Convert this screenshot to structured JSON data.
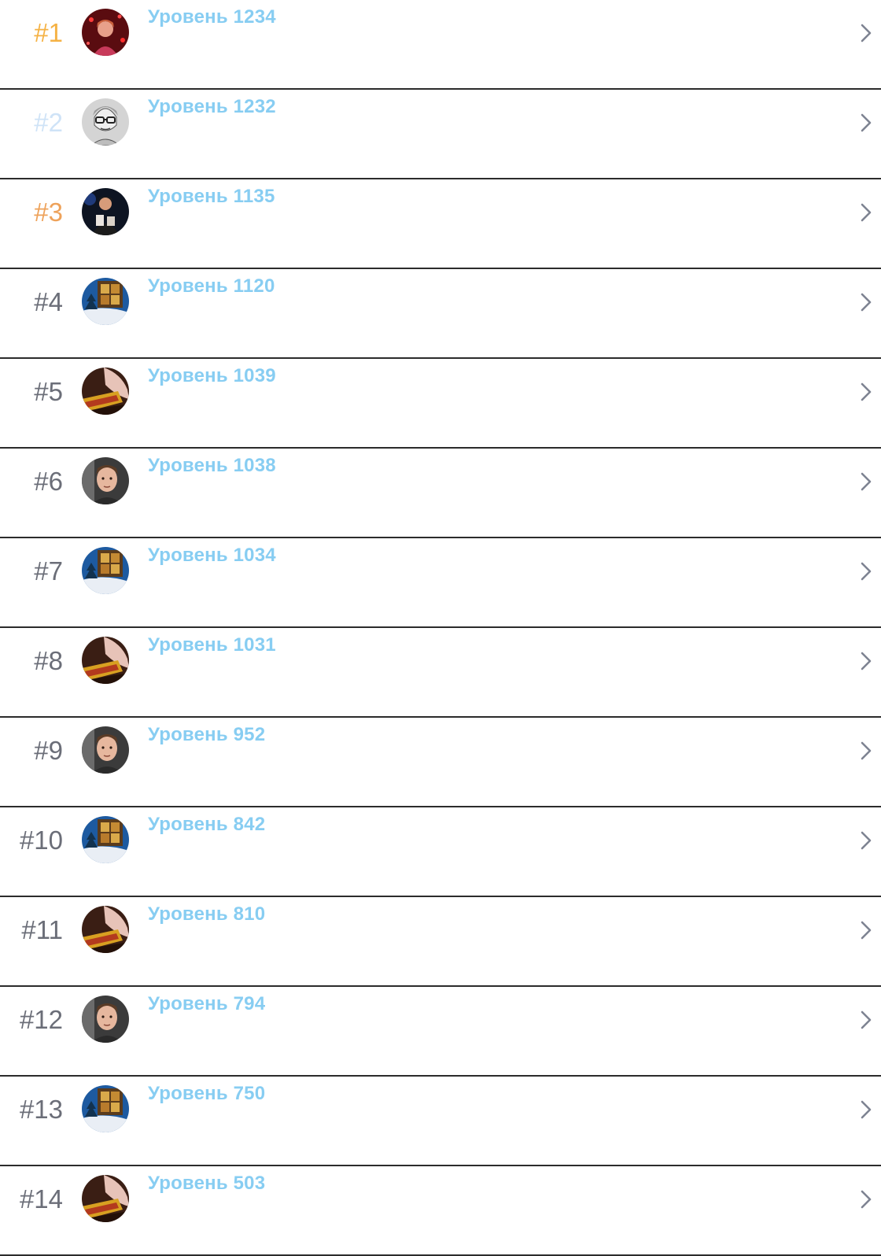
{
  "colors": {
    "rank_default": "#6b6e78",
    "rank_gold": "#f5b244",
    "rank_silver": "#cfe3f7",
    "rank_bronze": "#eea25a",
    "level_text": "#87cdf2",
    "divider": "#2b2b2b"
  },
  "rows": [
    {
      "rank": "#1",
      "level": "Уровень 1234",
      "medal": "gold",
      "avatar": "user-photo-red"
    },
    {
      "rank": "#2",
      "level": "Уровень 1232",
      "medal": "silver",
      "avatar": "user-photo-sketch"
    },
    {
      "rank": "#3",
      "level": "Уровень 1135",
      "medal": "bronze",
      "avatar": "user-photo-stage"
    },
    {
      "rank": "#4",
      "level": "Уровень 1120",
      "medal": "",
      "avatar": "user-photo-window"
    },
    {
      "rank": "#5",
      "level": "Уровень 1039",
      "medal": "",
      "avatar": "user-photo-hand"
    },
    {
      "rank": "#6",
      "level": "Уровень 1038",
      "medal": "",
      "avatar": "user-photo-face"
    },
    {
      "rank": "#7",
      "level": "Уровень 1034",
      "medal": "",
      "avatar": "user-photo-window"
    },
    {
      "rank": "#8",
      "level": "Уровень 1031",
      "medal": "",
      "avatar": "user-photo-hand"
    },
    {
      "rank": "#9",
      "level": "Уровень 952",
      "medal": "",
      "avatar": "user-photo-face"
    },
    {
      "rank": "#10",
      "level": "Уровень 842",
      "medal": "",
      "avatar": "user-photo-window"
    },
    {
      "rank": "#11",
      "level": "Уровень 810",
      "medal": "",
      "avatar": "user-photo-hand"
    },
    {
      "rank": "#12",
      "level": "Уровень 794",
      "medal": "",
      "avatar": "user-photo-face"
    },
    {
      "rank": "#13",
      "level": "Уровень 750",
      "medal": "",
      "avatar": "user-photo-window"
    },
    {
      "rank": "#14",
      "level": "Уровень 503",
      "medal": "",
      "avatar": "user-photo-hand"
    }
  ]
}
